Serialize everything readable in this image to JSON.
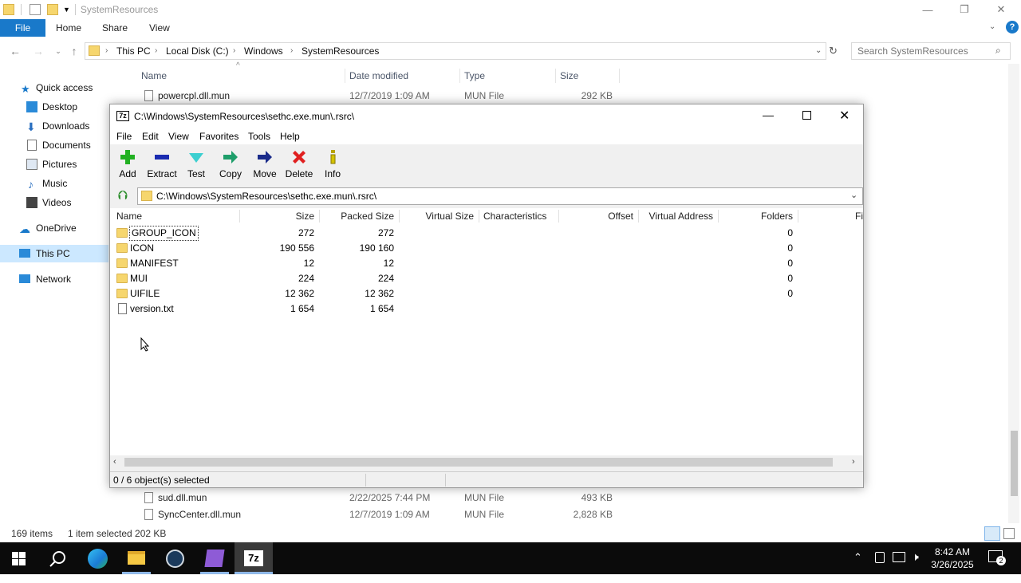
{
  "explorer": {
    "title": "SystemResources",
    "ribbon_tabs": [
      "File",
      "Home",
      "Share",
      "View"
    ],
    "breadcrumbs": [
      "This PC",
      "Local Disk (C:)",
      "Windows",
      "SystemResources"
    ],
    "search_placeholder": "Search SystemResources",
    "nav_items": [
      "Quick access",
      "Desktop",
      "Downloads",
      "Documents",
      "Pictures",
      "Music",
      "Videos",
      "OneDrive",
      "This PC",
      "Network"
    ],
    "columns": [
      "Name",
      "Date modified",
      "Type",
      "Size"
    ],
    "files_top": [
      {
        "name": "powercpl.dll.mun",
        "date": "12/7/2019 1:09 AM",
        "type": "MUN File",
        "size": "292 KB"
      }
    ],
    "files_bottom": [
      {
        "name": "sud.dll.mun",
        "date": "2/22/2025 7:44 PM",
        "type": "MUN File",
        "size": "493 KB"
      },
      {
        "name": "SyncCenter.dll.mun",
        "date": "12/7/2019 1:09 AM",
        "type": "MUN File",
        "size": "2,828 KB"
      }
    ],
    "status_items": "169 items",
    "status_selected": "1 item selected  202 KB"
  },
  "sevenzip": {
    "title": "C:\\Windows\\SystemResources\\sethc.exe.mun\\.rsrc\\",
    "menu": [
      "File",
      "Edit",
      "View",
      "Favorites",
      "Tools",
      "Help"
    ],
    "toolbar": [
      "Add",
      "Extract",
      "Test",
      "Copy",
      "Move",
      "Delete",
      "Info"
    ],
    "path": "C:\\Windows\\SystemResources\\sethc.exe.mun\\.rsrc\\",
    "columns": [
      "Name",
      "Size",
      "Packed Size",
      "Virtual Size",
      "Characteristics",
      "Offset",
      "Virtual Address",
      "Folders",
      "Fi"
    ],
    "rows": [
      {
        "name": "GROUP_ICON",
        "size": "272",
        "packed": "272",
        "folders": "0",
        "kind": "folder"
      },
      {
        "name": "ICON",
        "size": "190 556",
        "packed": "190 160",
        "folders": "0",
        "kind": "folder"
      },
      {
        "name": "MANIFEST",
        "size": "12",
        "packed": "12",
        "folders": "0",
        "kind": "folder"
      },
      {
        "name": "MUI",
        "size": "224",
        "packed": "224",
        "folders": "0",
        "kind": "folder"
      },
      {
        "name": "UIFILE",
        "size": "12 362",
        "packed": "12 362",
        "folders": "0",
        "kind": "folder"
      },
      {
        "name": "version.txt",
        "size": "1 654",
        "packed": "1 654",
        "folders": "",
        "kind": "file"
      }
    ],
    "status": "0 / 6 object(s) selected"
  },
  "taskbar": {
    "time": "8:42 AM",
    "date": "3/26/2025",
    "notification_count": "2"
  },
  "colors": {
    "accent": "#1979ca",
    "taskbar": "#0b0b0b"
  }
}
